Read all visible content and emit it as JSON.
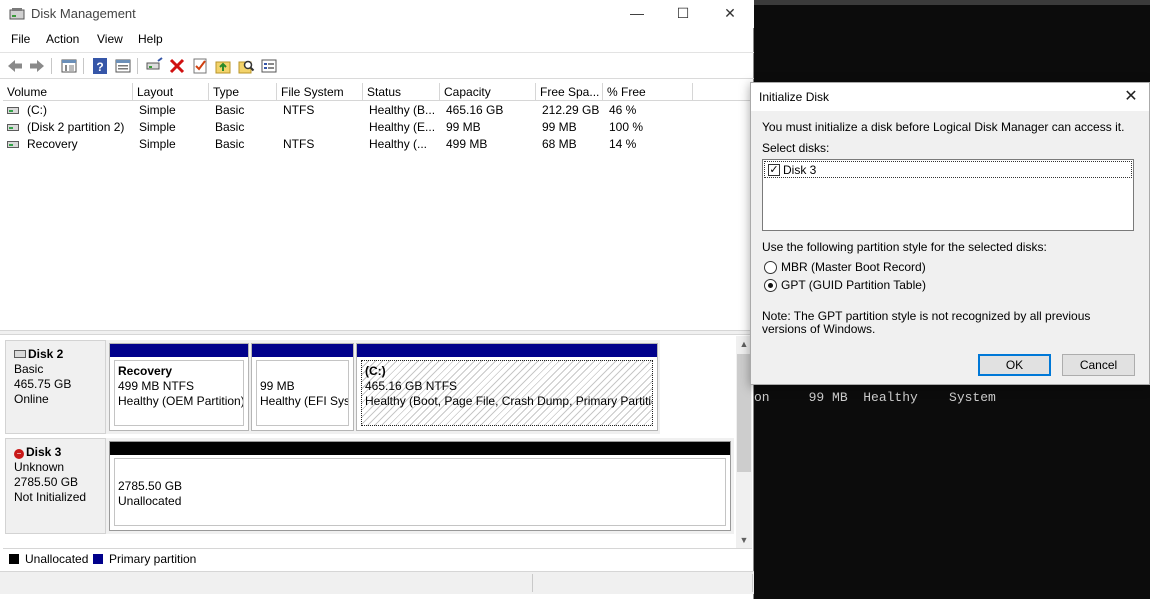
{
  "window": {
    "title": "Disk Management",
    "controls": {
      "minimize": "—",
      "maximize": "☐",
      "close": "✕"
    }
  },
  "menu": [
    "File",
    "Action",
    "View",
    "Help"
  ],
  "toolbar": {
    "icons": [
      "back-icon",
      "forward-icon",
      "console-tree-icon",
      "help-icon",
      "properties-icon",
      "connect-icon",
      "delete-icon",
      "check-icon",
      "folder-up-icon",
      "search-icon",
      "list-icon"
    ]
  },
  "volume_list": {
    "columns": [
      "Volume",
      "Layout",
      "Type",
      "File System",
      "Status",
      "Capacity",
      "Free Spa...",
      "% Free"
    ],
    "rows": [
      {
        "volume": "(C:)",
        "layout": "Simple",
        "type": "Basic",
        "fs": "NTFS",
        "status": "Healthy (B...",
        "capacity": "465.16 GB",
        "free": "212.29 GB",
        "pct": "46 %"
      },
      {
        "volume": "(Disk 2 partition 2)",
        "layout": "Simple",
        "type": "Basic",
        "fs": "",
        "status": "Healthy (E...",
        "capacity": "99 MB",
        "free": "99 MB",
        "pct": "100 %"
      },
      {
        "volume": "Recovery",
        "layout": "Simple",
        "type": "Basic",
        "fs": "NTFS",
        "status": "Healthy (...",
        "capacity": "499 MB",
        "free": "68 MB",
        "pct": "14 %"
      }
    ]
  },
  "disks": [
    {
      "name": "Disk 2",
      "kind": "Basic",
      "size": "465.75 GB",
      "state": "Online",
      "partitions": [
        {
          "name": "Recovery",
          "line1": "499 MB NTFS",
          "line2": "Healthy (OEM Partition)"
        },
        {
          "name": "",
          "line1": "99 MB",
          "line2": "Healthy (EFI Syste"
        },
        {
          "name": "(C:)",
          "line1": "465.16 GB NTFS",
          "line2": "Healthy (Boot, Page File, Crash Dump, Primary Partitio"
        }
      ]
    },
    {
      "name": "Disk 3",
      "kind": "Unknown",
      "size": "2785.50 GB",
      "state": "Not Initialized",
      "partitions": [
        {
          "name": "",
          "line1": "2785.50 GB",
          "line2": "Unallocated"
        }
      ]
    }
  ],
  "legend": [
    {
      "label": "Unallocated",
      "color": "#000000"
    },
    {
      "label": "Primary partition",
      "color": "#00008b"
    }
  ],
  "console": {
    "text": "on     99 MB  Healthy    System"
  },
  "dialog": {
    "title": "Initialize Disk",
    "intro": "You must initialize a disk before Logical Disk Manager can access it.",
    "select_label": "Select disks:",
    "disks": [
      {
        "label": "Disk 3",
        "checked": true
      }
    ],
    "style_label": "Use the following partition style for the selected disks:",
    "options": [
      {
        "label": "MBR (Master Boot Record)",
        "selected": false
      },
      {
        "label": "GPT (GUID Partition Table)",
        "selected": true
      }
    ],
    "note": "Note: The GPT partition style is not recognized by all previous versions of Windows.",
    "ok": "OK",
    "cancel": "Cancel"
  },
  "colors": {
    "primary_partition": "#00008b",
    "unallocated": "#000000",
    "accent": "#0078d7"
  }
}
